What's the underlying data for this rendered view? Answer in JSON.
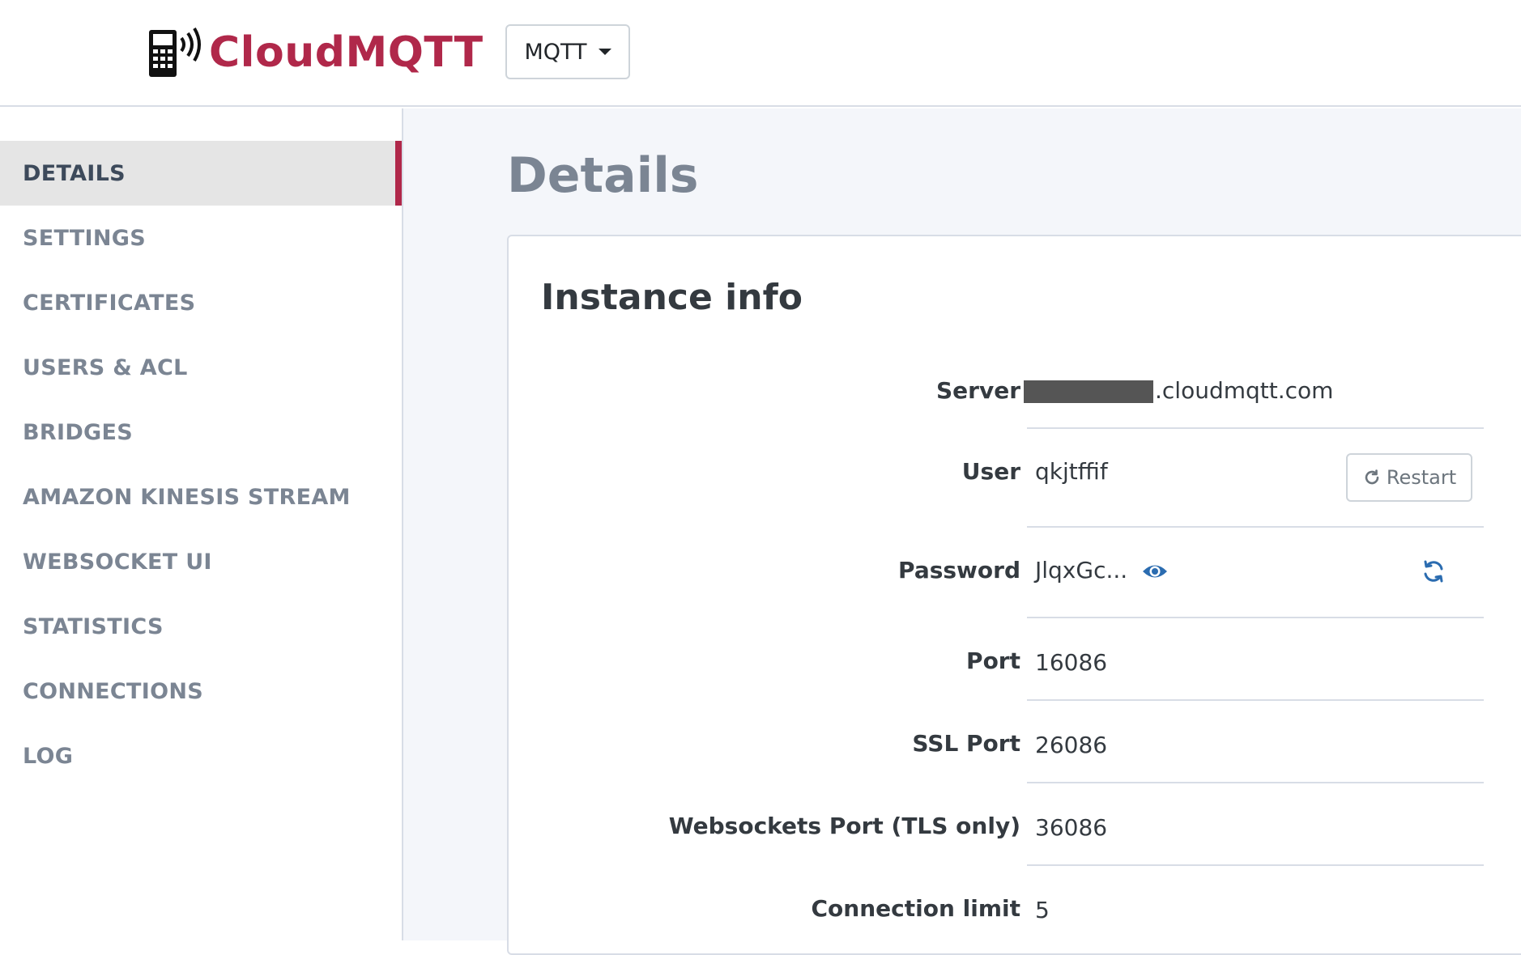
{
  "header": {
    "logo_text": "CloudMQTT",
    "logo_icon": "phone-signal-icon",
    "product_selector": "MQTT"
  },
  "sidebar": {
    "items": [
      {
        "label": "DETAILS",
        "active": true
      },
      {
        "label": "SETTINGS",
        "active": false
      },
      {
        "label": "CERTIFICATES",
        "active": false
      },
      {
        "label": "USERS & ACL",
        "active": false
      },
      {
        "label": "BRIDGES",
        "active": false
      },
      {
        "label": "AMAZON KINESIS STREAM",
        "active": false
      },
      {
        "label": "WEBSOCKET UI",
        "active": false
      },
      {
        "label": "STATISTICS",
        "active": false
      },
      {
        "label": "CONNECTIONS",
        "active": false
      },
      {
        "label": "LOG",
        "active": false
      }
    ]
  },
  "main": {
    "page_title": "Details",
    "card_title": "Instance info",
    "server": {
      "label": "Server",
      "value_suffix": ".cloudmqtt.com"
    },
    "user": {
      "label": "User",
      "value": "qkjtffif"
    },
    "restart_label": "Restart",
    "password": {
      "label": "Password",
      "value": "JlqxGc..."
    },
    "port": {
      "label": "Port",
      "value": "16086"
    },
    "ssl_port": {
      "label": "SSL Port",
      "value": "26086"
    },
    "websockets_port": {
      "label": "Websockets Port (TLS only)",
      "value": "36086"
    },
    "connection_limit": {
      "label": "Connection limit",
      "value": "5"
    }
  },
  "colors": {
    "brand": "#b0284a",
    "link_icon": "#2b6cb0",
    "muted_text": "#7b8593"
  }
}
